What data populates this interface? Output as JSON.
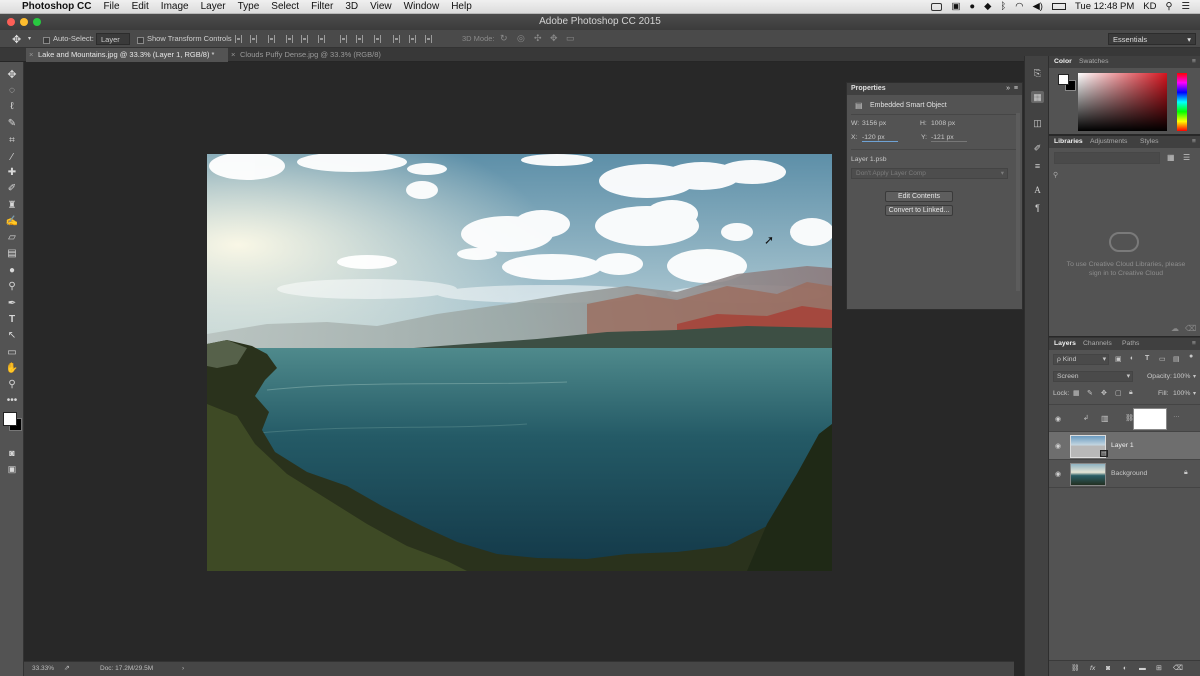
{
  "menubar": {
    "apple": "",
    "app_name": "Photoshop CC",
    "items": [
      "File",
      "Edit",
      "Image",
      "Layer",
      "Type",
      "Select",
      "Filter",
      "3D",
      "View",
      "Window",
      "Help"
    ],
    "clock": "Tue 12:48 PM",
    "user": "KD"
  },
  "window": {
    "title": "Adobe Photoshop CC 2015"
  },
  "options_bar": {
    "auto_select_label": "Auto-Select:",
    "auto_select_value": "Layer",
    "transform_label": "Show Transform Controls",
    "mode_3d_label": "3D Mode:",
    "workspace": "Essentials"
  },
  "tabs": [
    {
      "label": "Lake and Mountains.jpg @ 33.3% (Layer 1, RGB/8) *",
      "active": true
    },
    {
      "label": "Clouds Puffy Dense.jpg @ 33.3% (RGB/8)",
      "active": false
    }
  ],
  "properties": {
    "header": "Properties",
    "type_label": "Embedded Smart Object",
    "w_label": "W:",
    "w_value": "3156 px",
    "h_label": "H:",
    "h_value": "1008 px",
    "x_label": "X:",
    "x_value": "-120 px",
    "y_label": "Y:",
    "y_value": "-121 px",
    "file": "Layer 1.psb",
    "layer_comp_placeholder": "Don't Apply Layer Comp",
    "edit_contents": "Edit Contents",
    "convert_linked": "Convert to Linked..."
  },
  "color_panel": {
    "tabs": [
      "Color",
      "Swatches"
    ],
    "fg": "#ffffff",
    "bg": "#000000",
    "hue": "#d4141e"
  },
  "libraries": {
    "tabs": [
      "Libraries",
      "Adjustments",
      "Styles"
    ],
    "message": "To use Creative Cloud Libraries, please sign in to Creative Cloud"
  },
  "layers_panel": {
    "tabs": [
      "Layers",
      "Channels",
      "Paths"
    ],
    "filter_kind": "ρ Kind",
    "blend_mode": "Screen",
    "opacity_label": "Opacity:",
    "opacity": "100%",
    "lock_label": "Lock:",
    "fill_label": "Fill:",
    "fill": "100%",
    "layers": [
      {
        "name": "",
        "kind": "adjustment"
      },
      {
        "name": "Layer 1",
        "kind": "smart"
      },
      {
        "name": "Background",
        "kind": "background"
      }
    ]
  },
  "status": {
    "zoom": "33.33%",
    "doc": "Doc: 17.2M/29.5M"
  }
}
